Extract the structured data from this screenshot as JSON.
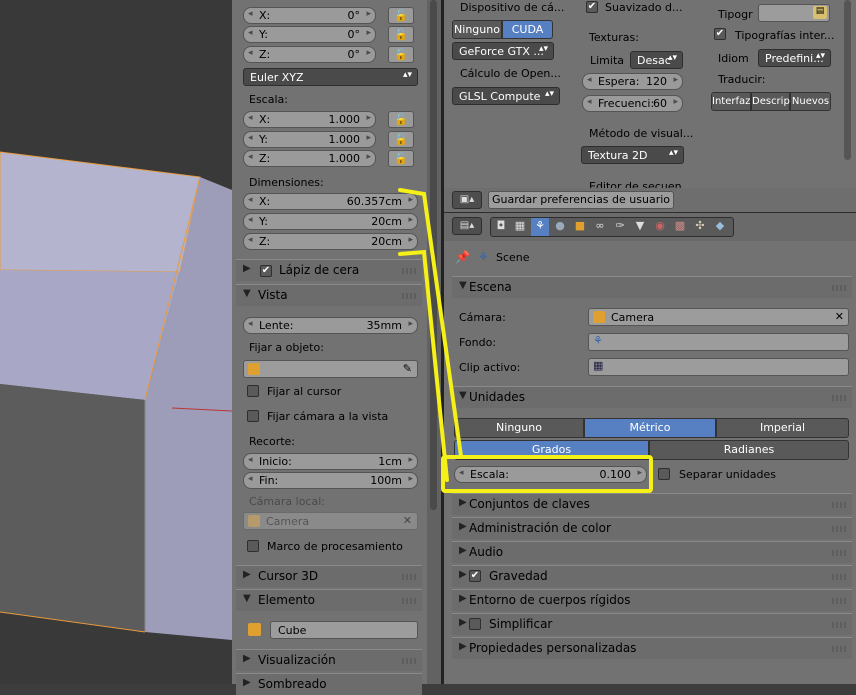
{
  "npanel": {
    "rotation": {
      "x_label": "X:",
      "x": "0°",
      "y_label": "Y:",
      "y": "0°",
      "z_label": "Z:",
      "z": "0°",
      "mode": "Euler XYZ"
    },
    "scale": {
      "label": "Escala:",
      "x_label": "X:",
      "x": "1.000",
      "y_label": "Y:",
      "y": "1.000",
      "z_label": "Z:",
      "z": "1.000"
    },
    "dimensions": {
      "label": "Dimensiones:",
      "x_label": "X:",
      "x": "60.357cm",
      "y_label": "Y:",
      "y": "20cm",
      "z_label": "Z:",
      "z": "20cm"
    },
    "grease_pencil": {
      "label": "Lápiz de cera",
      "checked": true
    },
    "view": {
      "label": "Vista",
      "lens_label": "Lente:",
      "lens": "35mm",
      "lock_object_label": "Fijar a objeto:",
      "lock_cursor_label": "Fijar al cursor",
      "lock_camera_label": "Fijar cámara a la vista",
      "clip_label": "Recorte:",
      "clip_start_label": "Inicio:",
      "clip_start": "1cm",
      "clip_end_label": "Fin:",
      "clip_end": "100m",
      "local_camera_label": "Cámara local:",
      "local_camera_value": "Camera",
      "render_border_label": "Marco de procesamiento"
    },
    "cursor3d": {
      "label": "Cursor 3D"
    },
    "item": {
      "label": "Elemento",
      "name": "Cube"
    },
    "display": {
      "label": "Visualización"
    },
    "shading": {
      "label": "Sombreado"
    }
  },
  "prefs": {
    "compute_device_label": "Dispositivo de cá...",
    "device_none": "Ninguno",
    "device_cuda": "CUDA",
    "gpu": "GeForce GTX ...",
    "opensubdiv_label": "Cálculo de Open...",
    "opensubdiv_value": "GLSL Compute",
    "smooth_label": "Suavizado d...",
    "textures_label": "Texturas:",
    "limit_label": "Limita",
    "limit_value": "Desac",
    "wait_label": "Espera:",
    "wait_value": "120",
    "freq_label": "Frecuenci:",
    "freq_value": "60",
    "visual_method_label": "Método de visual...",
    "visual_method_value": "Textura 2D",
    "editor_label": "Editor de secuen...",
    "font_label": "Tipogr",
    "intl_fonts_label": "Tipografías inter...",
    "language_label": "Idiom",
    "language_value": "Predefini...",
    "translate_label": "Traducir:",
    "translate_interface": "Interfaz",
    "translate_tooltips": "Descrip",
    "translate_new": "Nuevos",
    "save_button": "Guardar preferencias de usuario"
  },
  "properties": {
    "breadcrumb_scene": "Scene",
    "scene_panel": {
      "label": "Escena",
      "camera_label": "Cámara:",
      "camera_value": "Camera",
      "background_label": "Fondo:",
      "active_clip_label": "Clip activo:"
    },
    "units_panel": {
      "label": "Unidades",
      "systems": [
        "Ninguno",
        "Métrico",
        "Imperial"
      ],
      "active_system": "Métrico",
      "rotation": [
        "Grados",
        "Radianes"
      ],
      "active_rotation": "Grados",
      "scale_label": "Escala:",
      "scale_value": "0.100",
      "separate_label": "Separar unidades"
    },
    "collapsed_panels": [
      {
        "label": "Conjuntos de claves"
      },
      {
        "label": "Administración de color"
      },
      {
        "label": "Audio"
      },
      {
        "label": "Gravedad"
      },
      {
        "label": "Entorno de cuerpos rígidos"
      },
      {
        "label": "Simplificar"
      },
      {
        "label": "Propiedades personalizadas"
      }
    ]
  },
  "colors": {
    "highlight": "#f5f018",
    "selected_blue": "#5680c2",
    "cube_face": "#aeaec9",
    "cube_edge": "#e89a3c"
  }
}
